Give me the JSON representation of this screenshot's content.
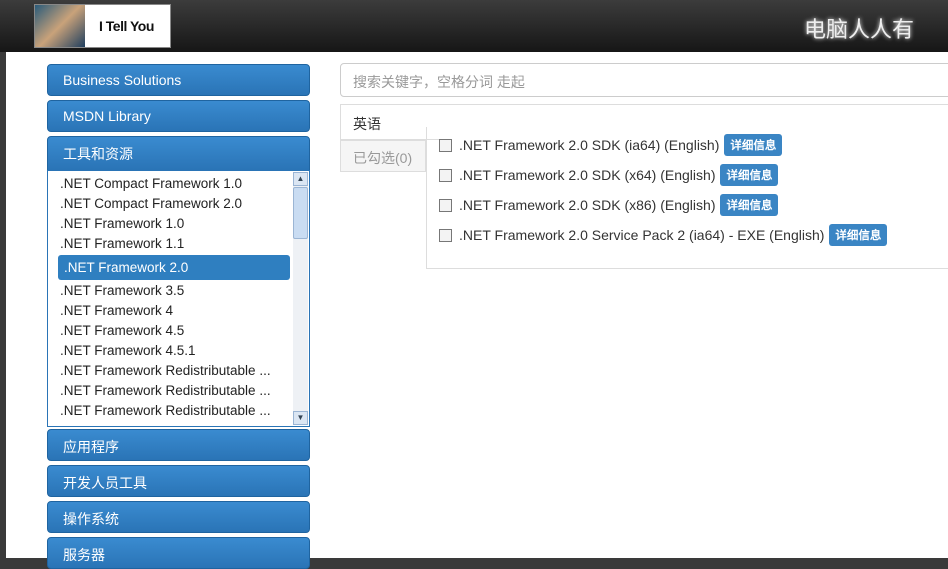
{
  "header": {
    "logo_text": "I Tell You",
    "slogan": "电脑人人有"
  },
  "sidebar": {
    "items": [
      {
        "label": "Business Solutions"
      },
      {
        "label": "MSDN Library"
      },
      {
        "label": "工具和资源"
      },
      {
        "label": "应用程序"
      },
      {
        "label": "开发人员工具"
      },
      {
        "label": "操作系统"
      },
      {
        "label": "服务器"
      }
    ],
    "products": [
      ".NET Compact Framework 1.0",
      ".NET Compact Framework 2.0",
      ".NET Framework 1.0",
      ".NET Framework 1.1",
      ".NET Framework 2.0",
      ".NET Framework 3.5",
      ".NET Framework 4",
      ".NET Framework 4.5",
      ".NET Framework 4.5.1",
      ".NET Framework Redistributable ...",
      ".NET Framework Redistributable ...",
      ".NET Framework Redistributable ..."
    ],
    "selected_index": 4
  },
  "search": {
    "placeholder": "搜索关键字，空格分词 走起"
  },
  "tabs": [
    {
      "label": "英语"
    },
    {
      "label": "已勾选(0)"
    }
  ],
  "files": [
    {
      "name": ".NET Framework 2.0 SDK (ia64) (English)",
      "details": "详细信息"
    },
    {
      "name": ".NET Framework 2.0 SDK (x64) (English)",
      "details": "详细信息"
    },
    {
      "name": ".NET Framework 2.0 SDK (x86) (English)",
      "details": "详细信息"
    },
    {
      "name": ".NET Framework 2.0 Service Pack 2 (ia64) - EXE (English)",
      "details": "详细信息"
    }
  ]
}
